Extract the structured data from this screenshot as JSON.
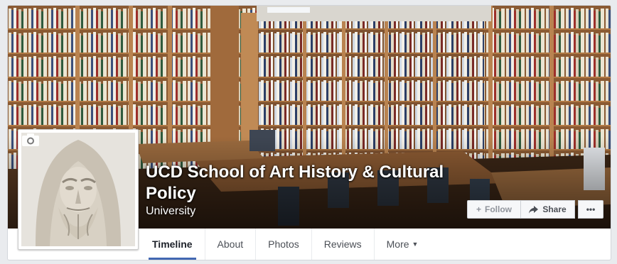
{
  "page": {
    "name": "UCD School of Art History & Cultural Policy",
    "category": "University"
  },
  "actions": {
    "follow_label": "Follow",
    "share_label": "Share",
    "more_label": "•••"
  },
  "tabs": [
    {
      "label": "Timeline",
      "active": true
    },
    {
      "label": "About"
    },
    {
      "label": "Photos"
    },
    {
      "label": "Reviews"
    },
    {
      "label": "More"
    }
  ],
  "icons": {
    "camera": "camera-icon",
    "share": "share-arrow-icon",
    "follow": "plus-icon",
    "more_caret": "caret-down-icon"
  },
  "colors": {
    "accent": "#4267b2",
    "background": "#e9ebee",
    "text": "#1d2129"
  }
}
